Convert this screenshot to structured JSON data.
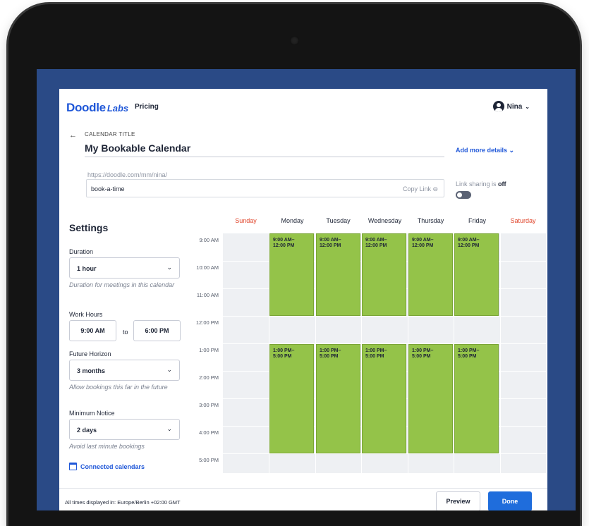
{
  "header": {
    "logo_main": "Doodle",
    "logo_sub": "Labs",
    "pricing": "Pricing",
    "user_name": "Nina",
    "user_chevron": "⌄"
  },
  "calendar": {
    "back_arrow": "←",
    "title_label": "CALENDAR TITLE",
    "name": "My Bookable Calendar",
    "add_more_details": "Add more details ⌄",
    "url_base": "https://doodle.com/mm/nina/",
    "slug": "book-a-time",
    "copy_link": "Copy Link ⊖",
    "link_sharing_prefix": "Link sharing is",
    "link_sharing_state": "off"
  },
  "settings": {
    "heading": "Settings",
    "duration_label": "Duration",
    "duration_value": "1 hour",
    "duration_hint": "Duration for meetings in this calendar",
    "work_hours_label": "Work Hours",
    "work_start": "9:00 AM",
    "work_to": "to",
    "work_end": "6:00 PM",
    "future_label": "Future Horizon",
    "future_value": "3 months",
    "future_hint": "Allow bookings this far in the future",
    "notice_label": "Minimum Notice",
    "notice_value": "2 days",
    "notice_hint": "Avoid last minute bookings",
    "connected_calendars": "Connected calendars",
    "select_arrow": "⌄"
  },
  "schedule": {
    "days": [
      "Sunday",
      "Monday",
      "Tuesday",
      "Wednesday",
      "Thursday",
      "Friday",
      "Saturday"
    ],
    "times": [
      "9:00 AM",
      "10:00 AM",
      "11:00 AM",
      "12:00 PM",
      "1:00 PM",
      "2:00 PM",
      "3:00 PM",
      "4:00 PM",
      "5:00 PM"
    ],
    "morning_block": [
      "9:00 AM–",
      "12:00 PM"
    ],
    "afternoon_block": [
      "1:00 PM–",
      "5:00 PM"
    ],
    "colors": {
      "weekend": "#e0442a",
      "available": "#94c349",
      "grid": "#eef0f3"
    }
  },
  "footer": {
    "timezone": "All times displayed in: Europe/Berlin +02:00 GMT",
    "preview": "Preview",
    "done": "Done"
  }
}
